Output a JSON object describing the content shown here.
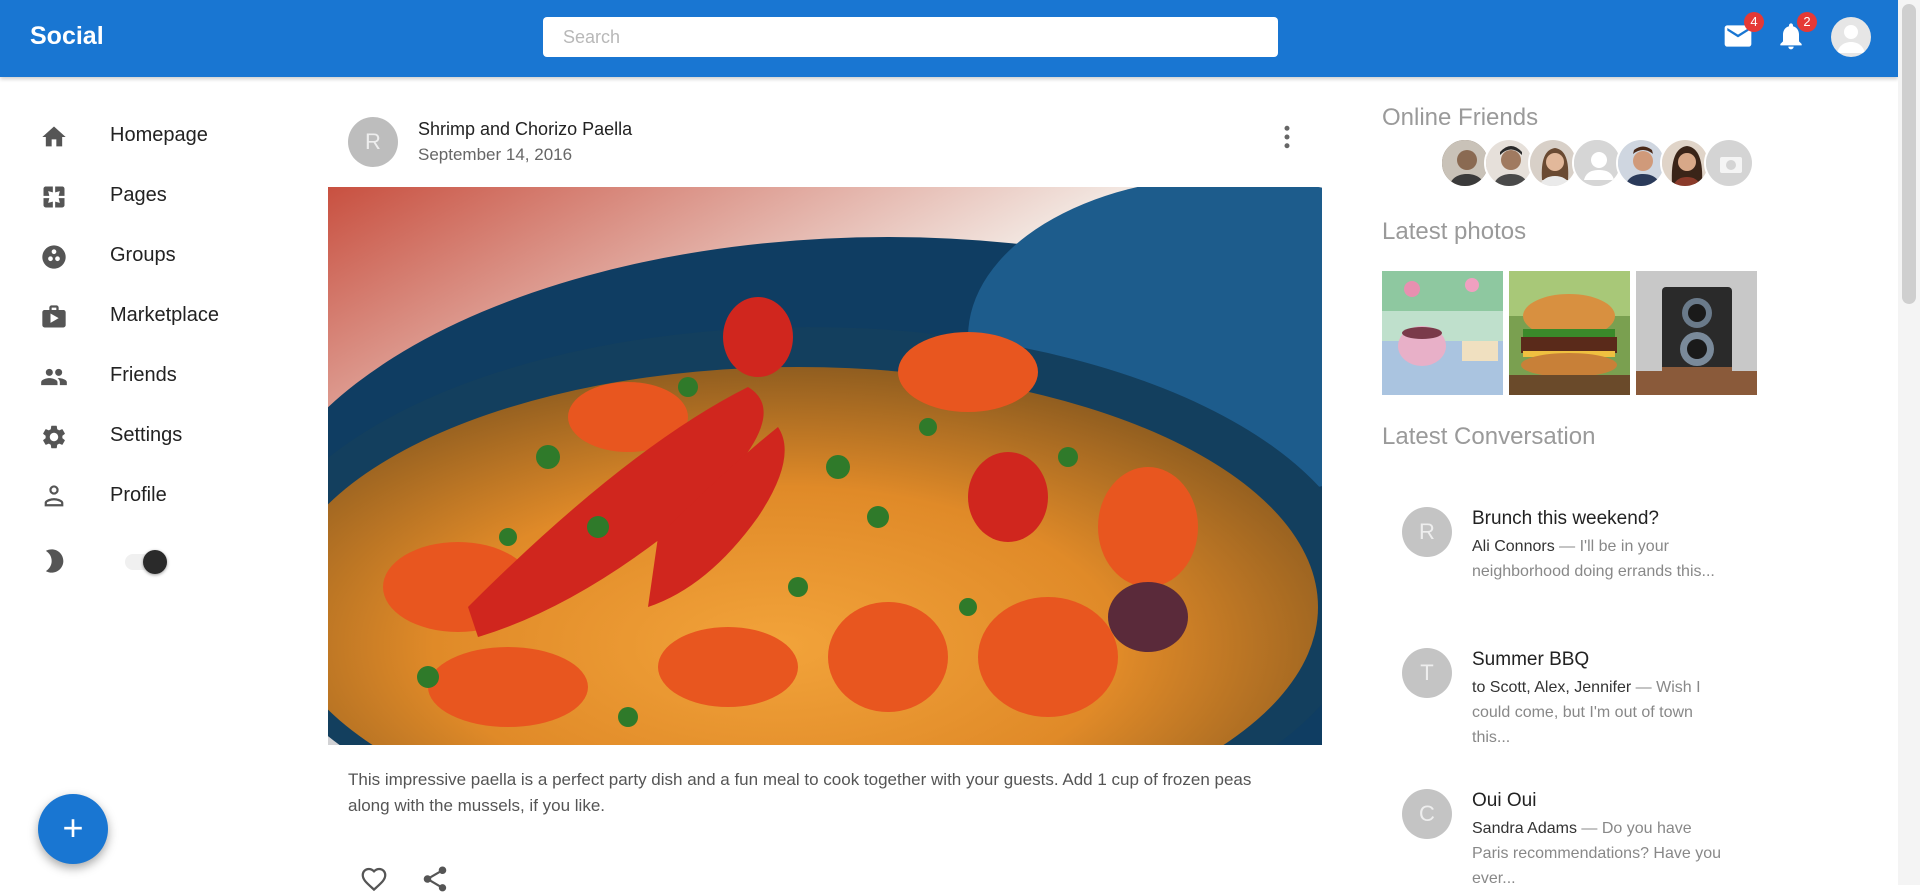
{
  "app": {
    "title": "Social"
  },
  "search": {
    "placeholder": "Search"
  },
  "header": {
    "mail_badge": "4",
    "notification_badge": "2",
    "icons": [
      "mail-icon",
      "bell-icon",
      "account-avatar-icon"
    ]
  },
  "nav": {
    "items": [
      {
        "label": "Homepage",
        "icon": "home-icon"
      },
      {
        "label": "Pages",
        "icon": "pages-icon"
      },
      {
        "label": "Groups",
        "icon": "groups-icon"
      },
      {
        "label": "Marketplace",
        "icon": "marketplace-icon"
      },
      {
        "label": "Friends",
        "icon": "friends-icon"
      },
      {
        "label": "Settings",
        "icon": "gear-icon"
      },
      {
        "label": "Profile",
        "icon": "profile-icon"
      }
    ],
    "dark_mode_icon": "moon-icon",
    "dark_mode_toggle": false
  },
  "fab": {
    "label": "+"
  },
  "post": {
    "avatar_initial": "R",
    "title": "Shrimp and Chorizo Paella",
    "date": "September 14, 2016",
    "text": "This impressive paella is a perfect party dish and a fun meal to cook together with your guests. Add 1 cup of frozen peas along with the mussels, if you like.",
    "actions": [
      "heart-icon",
      "share-icon"
    ]
  },
  "sidebar": {
    "online_friends_title": "Online Friends",
    "latest_photos_title": "Latest photos",
    "latest_conversation_title": "Latest Conversation",
    "conversations": [
      {
        "initial": "R",
        "title": "Brunch this weekend?",
        "from": "Ali Connors",
        "snippet": " — I'll be in your neighborhood doing errands this..."
      },
      {
        "initial": "T",
        "title": "Summer BBQ",
        "from": "to Scott, Alex, Jennifer",
        "snippet": " — Wish I could come, but I'm out of town this..."
      },
      {
        "initial": "C",
        "title": "Oui Oui",
        "from": "Sandra Adams",
        "snippet": " — Do you have Paris recommendations? Have you ever..."
      }
    ]
  },
  "colors": {
    "primary": "#1976d2",
    "badge": "#e53935"
  }
}
